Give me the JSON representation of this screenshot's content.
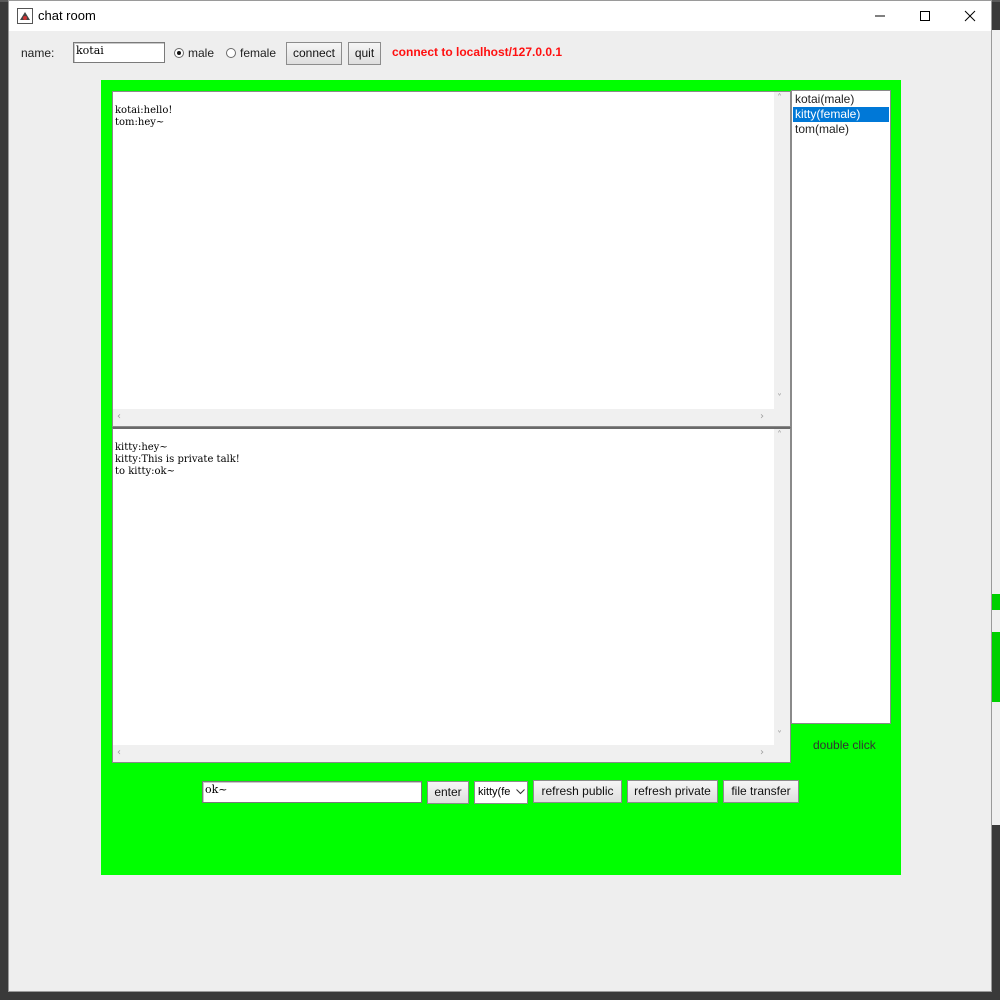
{
  "window": {
    "title": "chat room"
  },
  "toolbar": {
    "name_label": "name:",
    "name_value": "kotai",
    "gender_options": [
      "male",
      "female"
    ],
    "gender_selected": "male",
    "connect_label": "connect",
    "quit_label": "quit",
    "status": "connect to localhost/127.0.0.1"
  },
  "public_chat": {
    "text": "kotai:hello!\ntom:hey~"
  },
  "private_chat": {
    "text": "kitty:hey~\nkitty:This is private talk!\nto kitty:ok~"
  },
  "users": {
    "items": [
      "kotai(male)",
      "kitty(female)",
      "tom(male)"
    ],
    "selected": "kitty(female)",
    "hint": "double click"
  },
  "compose": {
    "message_value": "ok~",
    "enter_label": "enter",
    "recipient_selected": "kitty(fe",
    "refresh_public_label": "refresh public",
    "refresh_private_label": "refresh private",
    "file_transfer_label": "file transfer"
  },
  "colors": {
    "panel_green": "#00ff00",
    "status_red": "#ff1010",
    "selection_blue": "#0078d7"
  }
}
